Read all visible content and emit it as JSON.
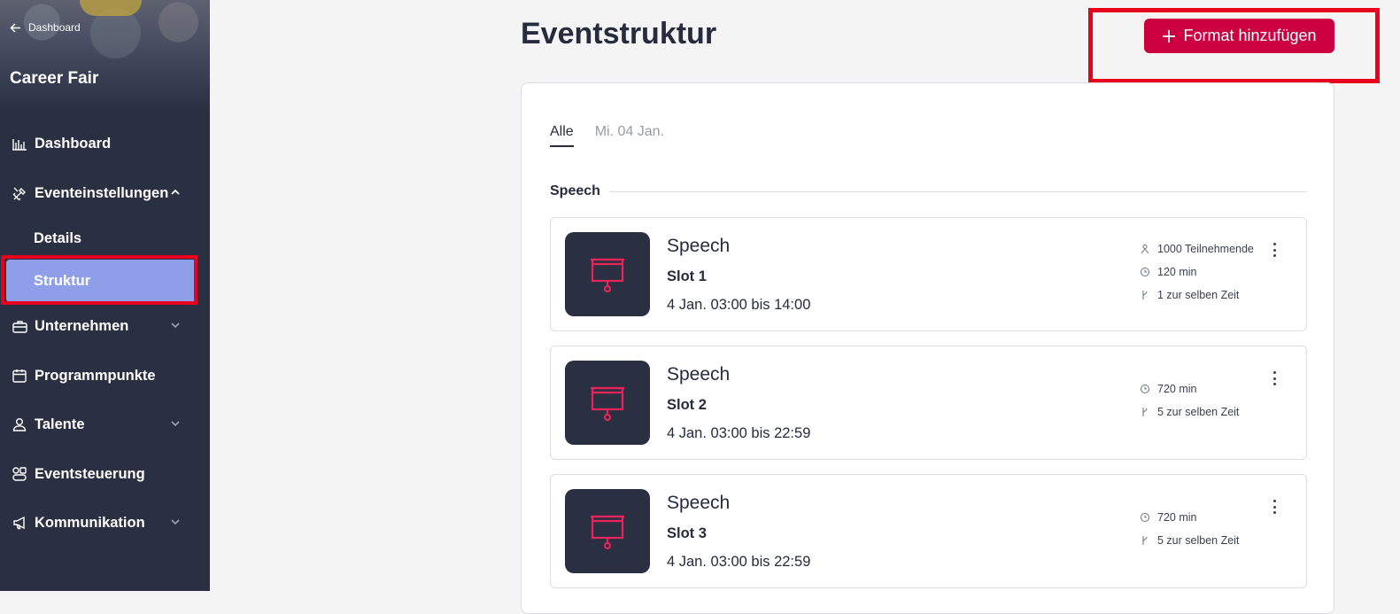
{
  "sidebar": {
    "back_label": "Dashboard",
    "event_name": "Career Fair",
    "items": {
      "dashboard": "Dashboard",
      "event_settings": "Eventeinstellungen",
      "details": "Details",
      "structure": "Struktur",
      "companies": "Unternehmen",
      "program": "Programmpunkte",
      "talents": "Talente",
      "control": "Eventsteuerung",
      "communication": "Kommunikation"
    },
    "active_color": "#8e9ee8"
  },
  "header": {
    "title": "Eventstruktur",
    "add_button_label": "Format hinzufügen",
    "accent": "#cc0040"
  },
  "tabs": [
    "Alle",
    "Mi. 04 Jan."
  ],
  "section_label": "Speech",
  "formats": [
    {
      "title": "Speech",
      "slot": "Slot 1",
      "time": "4 Jan. 03:00 bis 14:00",
      "participants": "1000 Teilnehmende",
      "duration": "120 min",
      "concurrent": "1 zur selben Zeit"
    },
    {
      "title": "Speech",
      "slot": "Slot 2",
      "time": "4 Jan. 03:00 bis 22:59",
      "duration": "720 min",
      "concurrent": "5 zur selben Zeit"
    },
    {
      "title": "Speech",
      "slot": "Slot 3",
      "time": "4 Jan. 03:00 bis 22:59",
      "duration": "720 min",
      "concurrent": "5 zur selben Zeit"
    }
  ],
  "annotation_color": "#e8001c"
}
